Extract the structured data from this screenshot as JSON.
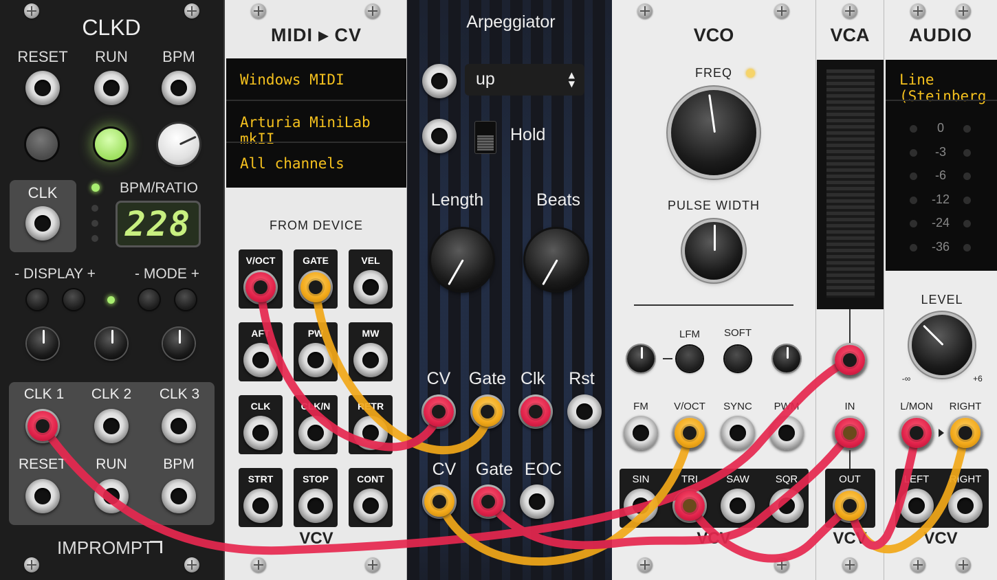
{
  "colors": {
    "cable_red": "#e6284f",
    "cable_yellow": "#f2a819",
    "led_green": "#b6f07a",
    "display_text": "#c8f080"
  },
  "clkd": {
    "title": "CLKD",
    "top_labels": [
      "RESET",
      "RUN",
      "BPM"
    ],
    "clk_label": "CLK",
    "bpm_ratio_label": "BPM/RATIO",
    "display_value": "228",
    "display_label": "- DISPLAY +",
    "mode_label": "- MODE +",
    "out_labels": [
      "CLK 1",
      "CLK 2",
      "CLK 3"
    ],
    "bottom_labels": [
      "RESET",
      "RUN",
      "BPM"
    ],
    "brand": "IMPROMPT"
  },
  "midi": {
    "title": "MIDI ▸ CV",
    "driver": "Windows MIDI",
    "device": "Arturia MiniLab mkII",
    "channel": "All channels",
    "section_label": "FROM DEVICE",
    "jacks": [
      "V/OCT",
      "GATE",
      "VEL",
      "AFT",
      "PW",
      "MW",
      "CLK",
      "CLK/N",
      "RETR",
      "STRT",
      "STOP",
      "CONT"
    ],
    "brand": "VCV"
  },
  "arp": {
    "title": "Arpeggiator",
    "mode": "up",
    "hold_label": "Hold",
    "length_label": "Length",
    "beats_label": "Beats",
    "input_labels": [
      "CV",
      "Gate",
      "Clk",
      "Rst"
    ],
    "output_labels": [
      "CV",
      "Gate",
      "EOC"
    ]
  },
  "vco": {
    "title": "VCO",
    "freq_label": "FREQ",
    "pw_label": "PULSE WIDTH",
    "lfm_label": "LFM",
    "soft_label": "SOFT",
    "in_labels": [
      "FM",
      "V/OCT",
      "SYNC",
      "PWM"
    ],
    "out_labels": [
      "SIN",
      "TRI",
      "SAW",
      "SQR"
    ],
    "brand": "VCV"
  },
  "vca": {
    "title": "VCA",
    "in_label": "IN",
    "out_label": "OUT",
    "brand": "VCV"
  },
  "audio": {
    "title": "AUDIO",
    "device": "Line (Steinberg",
    "meter_labels": [
      "0",
      "-3",
      "-6",
      "-12",
      "-24",
      "-36"
    ],
    "level_label": "LEVEL",
    "range_min": "-∞",
    "range_max": "+6",
    "in_labels": [
      "L/MON",
      "RIGHT"
    ],
    "out_labels": [
      "LEFT",
      "RIGHT"
    ],
    "brand": "VCV"
  }
}
